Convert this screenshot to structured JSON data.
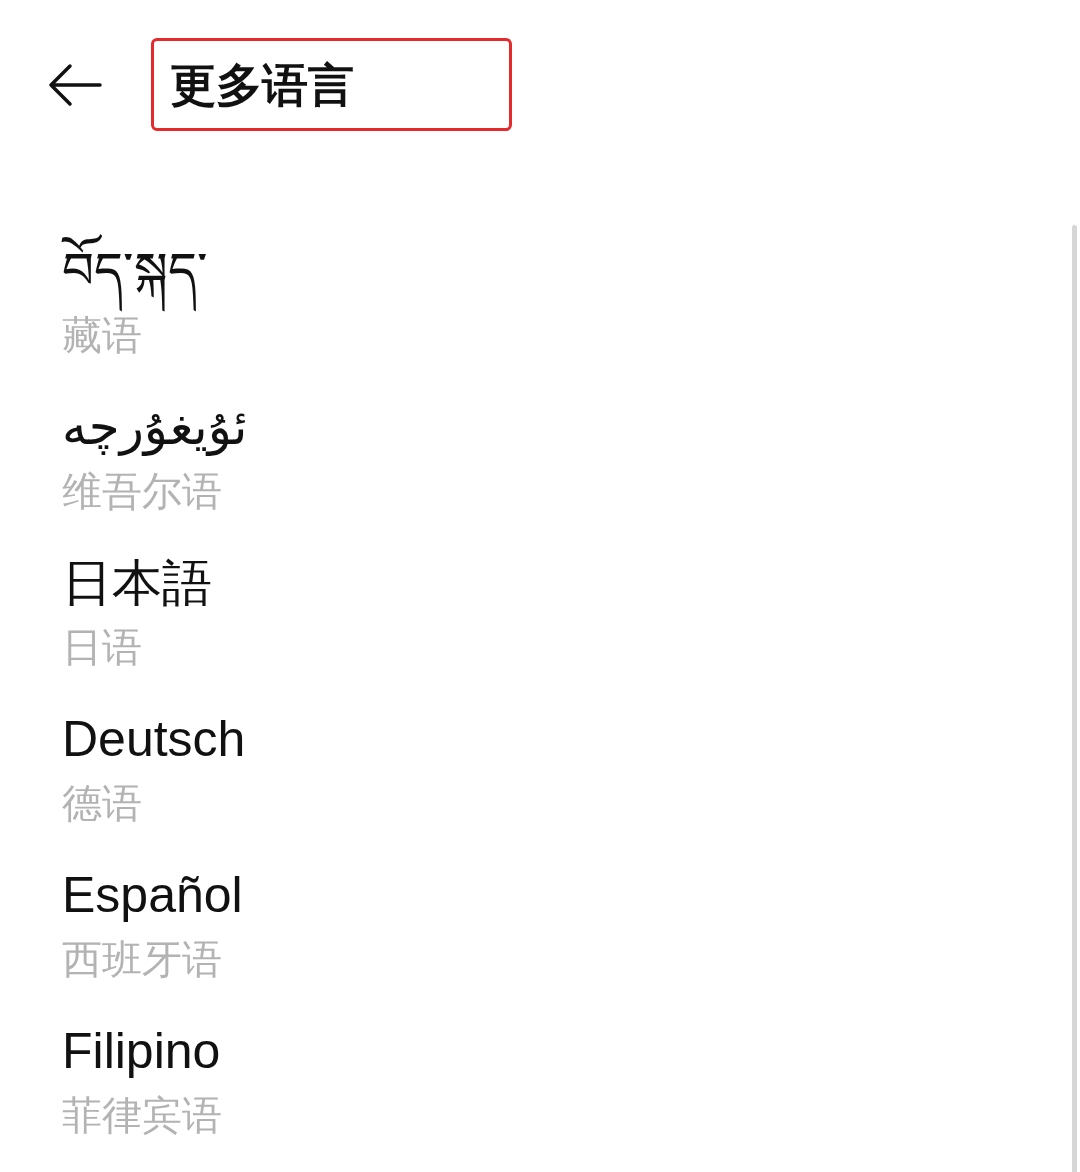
{
  "header": {
    "title": "更多语言",
    "highlighted": true
  },
  "languages": [
    {
      "name": "བོད་སྐད་",
      "translation": "藏语"
    },
    {
      "name": "ئۇيغۇرچە",
      "translation": "维吾尔语"
    },
    {
      "name": "日本語",
      "translation": "日语"
    },
    {
      "name": "Deutsch",
      "translation": "德语"
    },
    {
      "name": "Español",
      "translation": "西班牙语"
    },
    {
      "name": "Filipino",
      "translation": "菲律宾语"
    }
  ]
}
